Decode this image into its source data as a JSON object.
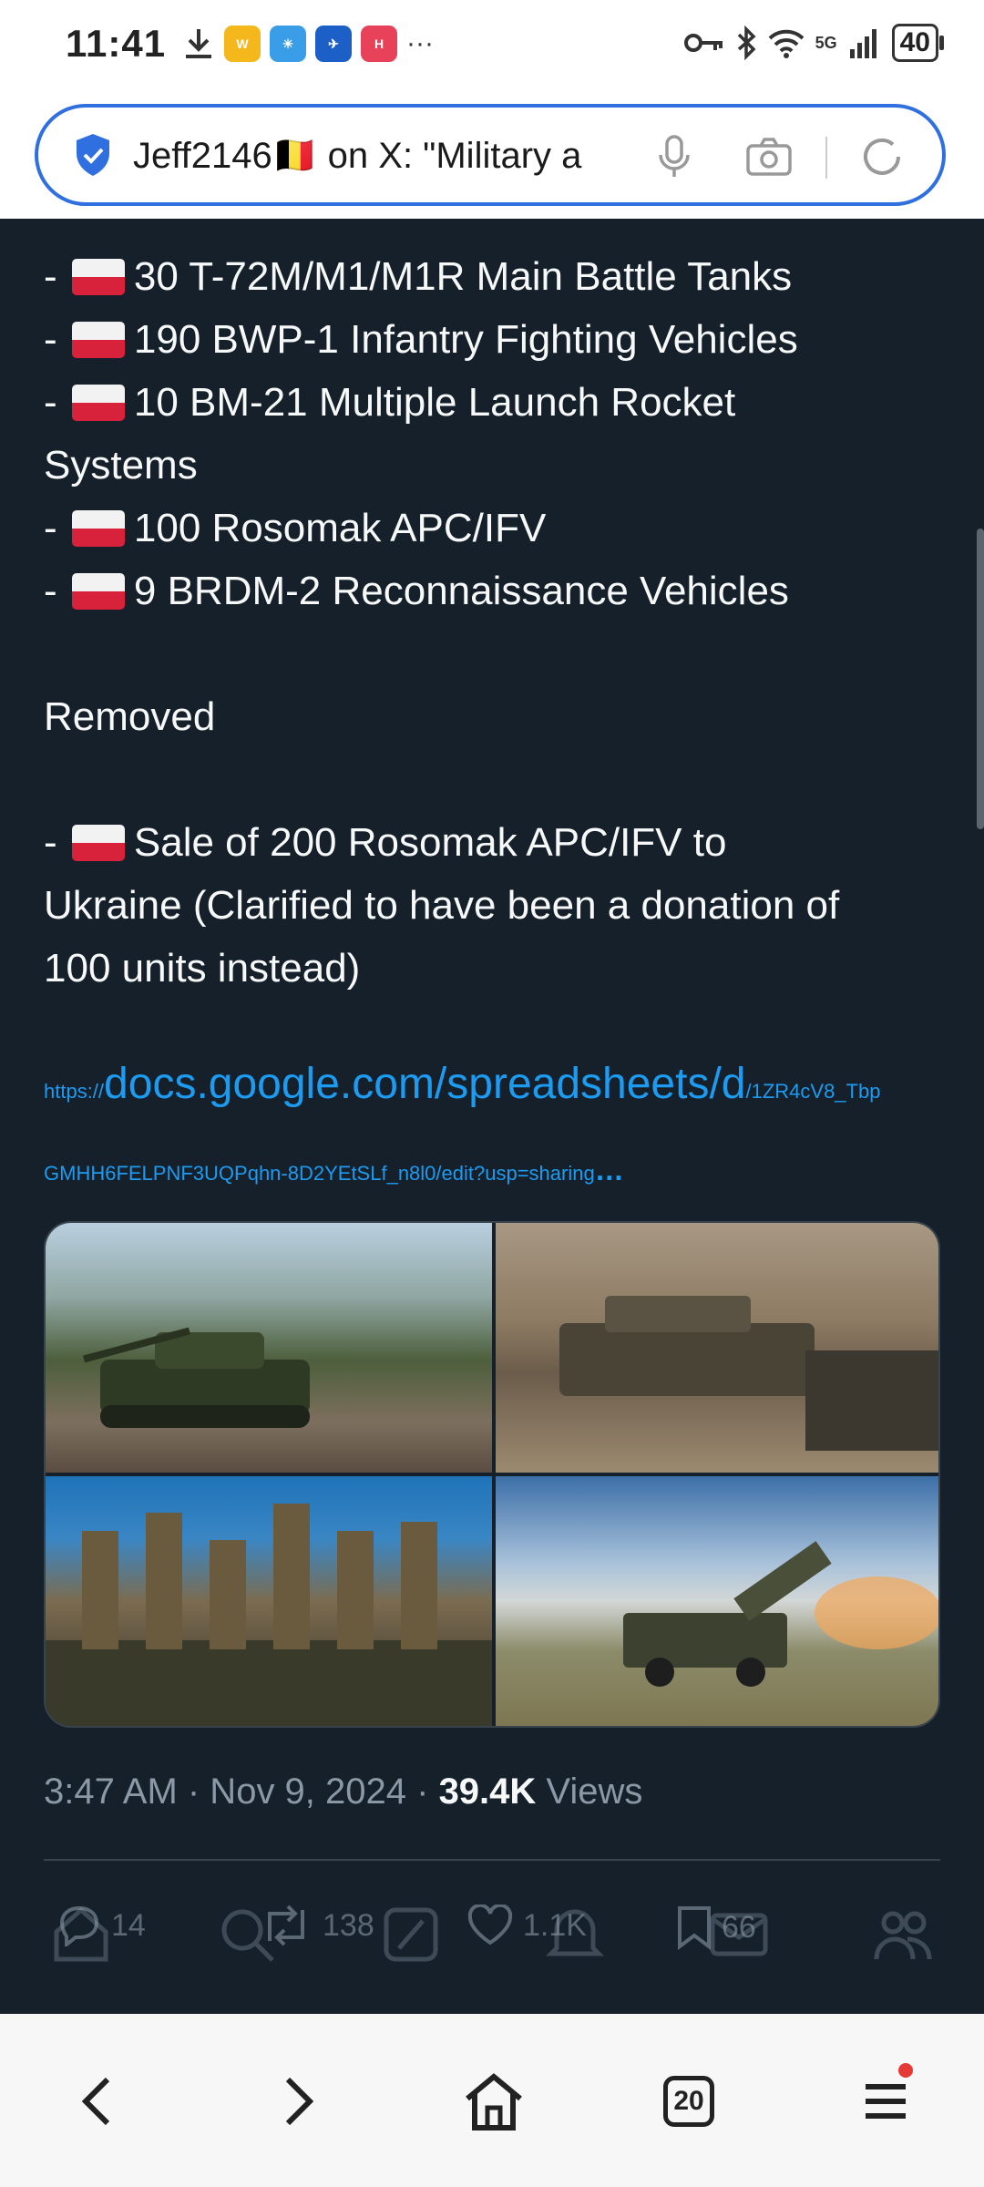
{
  "status_bar": {
    "time": "11:41",
    "network": "5G",
    "battery": "40",
    "more": "···"
  },
  "browser": {
    "url_title": "Jeff2146🇧🇪 on X: \"Military a",
    "tab_count": "20"
  },
  "tweet": {
    "lines": [
      "- ",
      "30 T-72M/M1/M1R Main Battle Tanks",
      "190 BWP-1 Infantry Fighting Vehicles",
      "10 BM-21 Multiple Launch Rocket",
      "Systems",
      "100 Rosomak APC/IFV",
      "9 BRDM-2 Reconnaissance Vehicles",
      "Removed",
      "Sale of 200 Rosomak APC/IFV to",
      "Ukraine (Clarified to have been a donation of",
      "100 units instead)"
    ],
    "link": {
      "prefix": "https://",
      "main": "docs.google.com/spreadsheets/d",
      "suffix": "/1ZR4cV8_Tbp",
      "line2": "GMHH6FELPNF3UQPqhn-8D2YEtSLf_n8l0/edit?usp=sharing",
      "ellipsis": "…"
    },
    "time": "3:47 AM · Nov 9, 2024 · ",
    "views_count": "39.4K",
    "views_label": " Views"
  },
  "actions": {
    "replies": "14",
    "reposts": "138",
    "likes": "1.1K",
    "bookmarks": "66"
  },
  "colors": {
    "background": "#15202b",
    "link": "#1d9bf0",
    "accent": "#2f6fe0"
  }
}
